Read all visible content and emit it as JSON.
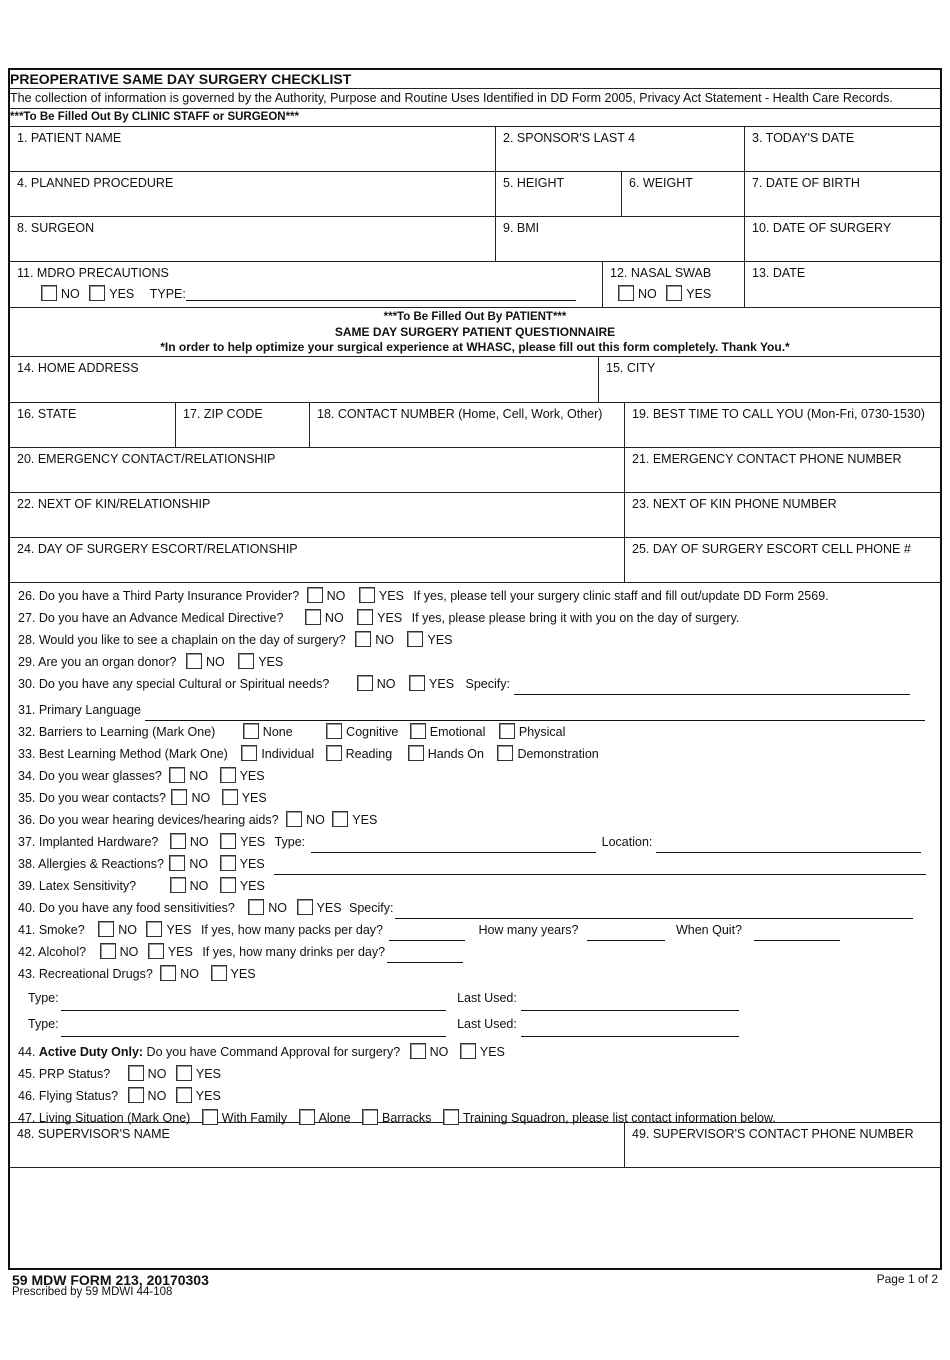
{
  "form": {
    "title": "PREOPERATIVE SAME DAY SURGERY CHECKLIST",
    "notice": "The collection of information is governed by the Authority, Purpose and Routine Uses Identified in DD Form 2005, Privacy Act Statement - Health Care Records.",
    "staff_banner": "***To Be Filled Out By CLINIC STAFF or SURGEON***",
    "patient_banner": {
      "line1": "***To Be Filled Out By PATIENT***",
      "line2": "SAME DAY SURGERY PATIENT QUESTIONNAIRE",
      "line3": "*In order to help optimize your surgical experience at WHASC, please fill out this form completely.  Thank You.*"
    }
  },
  "fields": {
    "f1": "1.  PATIENT NAME",
    "f2": "2.  SPONSOR'S LAST 4",
    "f3": "3.  TODAY'S DATE",
    "f4": "4.  PLANNED PROCEDURE",
    "f5": "5.  HEIGHT",
    "f6": "6.  WEIGHT",
    "f7": "7.  DATE OF BIRTH",
    "f8": "8.  SURGEON",
    "f9": "9.  BMI",
    "f10": "10. DATE OF SURGERY",
    "f11": "11.  MDRO PRECAUTIONS",
    "f11_type": "TYPE:",
    "f12": "12.  NASAL SWAB",
    "f13": "13.  DATE",
    "f14": "14.  HOME ADDRESS",
    "f15": "15.  CITY",
    "f16": "16.  STATE",
    "f17": "17.  ZIP CODE",
    "f18": "18.  CONTACT NUMBER  (Home, Cell, Work, Other)",
    "f19": "19.  BEST TIME TO CALL YOU (Mon-Fri, 0730-1530)",
    "f20": "20.  EMERGENCY CONTACT/RELATIONSHIP",
    "f21": "21.  EMERGENCY CONTACT PHONE NUMBER",
    "f22": "22.  NEXT OF KIN/RELATIONSHIP",
    "f23": "23.  NEXT OF KIN PHONE NUMBER",
    "f24": "24.  DAY OF SURGERY ESCORT/RELATIONSHIP",
    "f25": "25.  DAY OF SURGERY ESCORT CELL PHONE #",
    "f48": "48.  SUPERVISOR'S NAME",
    "f49": "49.  SUPERVISOR'S CONTACT PHONE NUMBER"
  },
  "opts": {
    "no": "NO",
    "yes": "YES"
  },
  "questions": {
    "q26": {
      "label": "26.  Do you have a Third Party Insurance Provider?",
      "note": "If yes, please tell your surgery clinic staff and fill out/update DD Form 2569."
    },
    "q27": {
      "label": "27.  Do you have an Advance Medical Directive?",
      "note": "If yes, please please bring it with you on the day of surgery."
    },
    "q28": {
      "label": "28.  Would you like to see a chaplain on the day of surgery?"
    },
    "q29": {
      "label": "29.  Are you an organ donor?"
    },
    "q30": {
      "label": "30.  Do you have any special Cultural or Spiritual needs?",
      "specify": "Specify:"
    },
    "q31": {
      "label": "31.  Primary Language"
    },
    "q32": {
      "label": "32.  Barriers to Learning (Mark One)",
      "options": [
        "None",
        "Cognitive",
        "Emotional",
        "Physical"
      ]
    },
    "q33": {
      "label": "33.  Best Learning Method (Mark One)",
      "options": [
        "Individual",
        "Reading",
        "Hands On",
        "Demonstration"
      ]
    },
    "q34": {
      "label": "34.  Do you wear glasses?"
    },
    "q35": {
      "label": "35.  Do you wear contacts?"
    },
    "q36": {
      "label": "36.  Do you wear hearing devices/hearing aids?"
    },
    "q37": {
      "label": "37.  Implanted Hardware?",
      "type": "Type:",
      "location": "Location:"
    },
    "q38": {
      "label": "38.  Allergies & Reactions?"
    },
    "q39": {
      "label": "39.  Latex Sensitivity?"
    },
    "q40": {
      "label": "40.  Do you have any food sensitivities?",
      "specify": "Specify:"
    },
    "q41": {
      "label": "41.  Smoke?",
      "packs": "If yes, how many packs per day?",
      "years": "How many years?",
      "quit": "When Quit?"
    },
    "q42": {
      "label": "42.  Alcohol?",
      "drinks": "If yes, how many drinks per day?"
    },
    "q43": {
      "label": "43.  Recreational Drugs?",
      "type": "Type:",
      "last_used": "Last Used:"
    },
    "q44": {
      "num": "44.",
      "bold": "Active Duty Only:",
      "label": "Do you have Command Approval for surgery?"
    },
    "q45": {
      "label": "45.  PRP Status?"
    },
    "q46": {
      "label": "46.  Flying Status?"
    },
    "q47": {
      "label": "47. Living Situation (Mark One)",
      "options": [
        "With Family",
        "Alone",
        "Barracks",
        "Training Squadron, please list contact information below."
      ]
    }
  },
  "footer": {
    "form_id": "59 MDW FORM 213, 20170303",
    "prescribed": "Prescribed by 59 MDWI 44-108",
    "page": "Page 1 of 2"
  }
}
